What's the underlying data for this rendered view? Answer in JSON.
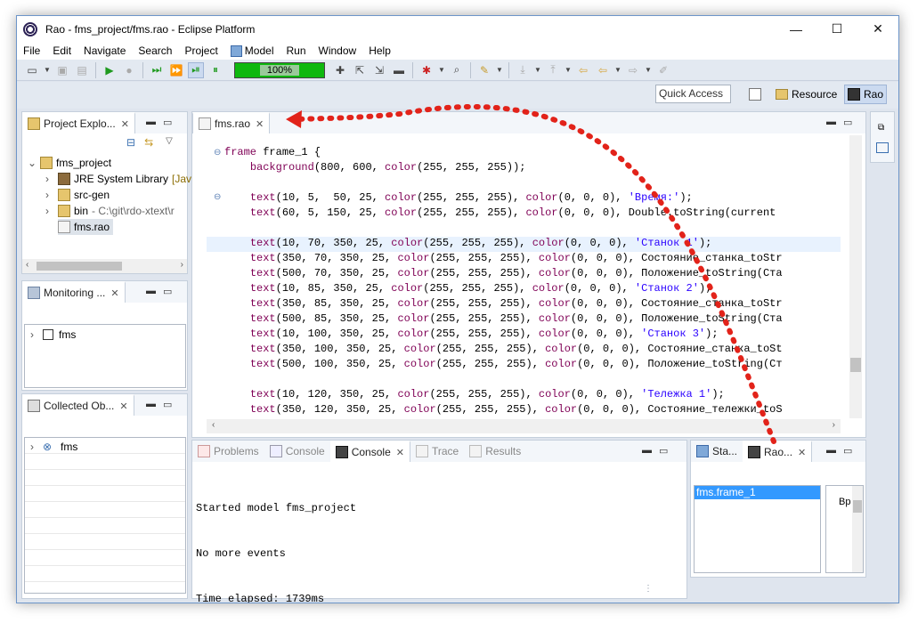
{
  "window": {
    "title": "Rao - fms_project/fms.rao - Eclipse Platform",
    "min_glyph": "—",
    "max_glyph": "☐",
    "close_glyph": "✕"
  },
  "menu": [
    "File",
    "Edit",
    "Navigate",
    "Search",
    "Project",
    "Model",
    "Run",
    "Window",
    "Help"
  ],
  "toolbar": {
    "speed_label": "100%",
    "quick_access_placeholder": "Quick Access"
  },
  "perspectives": {
    "resource_label": "Resource",
    "rao_label": "Rao"
  },
  "project_explorer": {
    "tab_label": "Project Explo...",
    "tree": [
      {
        "label": "fms_project",
        "expanded": true,
        "level": 0
      },
      {
        "label": "JRE System Library",
        "suffix": "[Java",
        "level": 1
      },
      {
        "label": "src-gen",
        "level": 1
      },
      {
        "label": "bin",
        "suffix": "- C:\\git\\rdo-xtext\\r",
        "level": 1
      },
      {
        "label": "fms.rao",
        "selected": true,
        "level": 1
      }
    ]
  },
  "monitoring": {
    "tab_label": "Monitoring ...",
    "items": [
      {
        "label": "fms"
      }
    ]
  },
  "collected": {
    "tab_label": "Collected Ob...",
    "items": [
      {
        "label": "fms"
      }
    ]
  },
  "editor": {
    "tab_label": "fms.rao",
    "lines": [
      [
        {
          "t": "kw",
          "v": "frame"
        },
        {
          "t": "plain",
          "v": " frame_1 {"
        }
      ],
      [
        {
          "t": "plain",
          "v": "    "
        },
        {
          "t": "kw",
          "v": "background"
        },
        {
          "t": "plain",
          "v": "(800, 600, "
        },
        {
          "t": "kw",
          "v": "color"
        },
        {
          "t": "plain",
          "v": "(255, 255, 255));"
        }
      ],
      [],
      [
        {
          "t": "plain",
          "v": "    "
        },
        {
          "t": "kw",
          "v": "text"
        },
        {
          "t": "plain",
          "v": "(10, 5,  50, 25, "
        },
        {
          "t": "kw",
          "v": "color"
        },
        {
          "t": "plain",
          "v": "(255, 255, 255), "
        },
        {
          "t": "kw",
          "v": "color"
        },
        {
          "t": "plain",
          "v": "(0, 0, 0), "
        },
        {
          "t": "str",
          "v": "'Время:'"
        },
        {
          "t": "plain",
          "v": ");"
        }
      ],
      [
        {
          "t": "plain",
          "v": "    "
        },
        {
          "t": "kw",
          "v": "text"
        },
        {
          "t": "plain",
          "v": "(60, 5, 150, 25, "
        },
        {
          "t": "kw",
          "v": "color"
        },
        {
          "t": "plain",
          "v": "(255, 255, 255), "
        },
        {
          "t": "kw",
          "v": "color"
        },
        {
          "t": "plain",
          "v": "(0, 0, 0), Double.toString(current"
        }
      ],
      [],
      [
        {
          "t": "plain",
          "v": "    "
        },
        {
          "t": "kw",
          "v": "text"
        },
        {
          "t": "plain",
          "v": "(10, 70, 350, 25, "
        },
        {
          "t": "kw",
          "v": "color"
        },
        {
          "t": "plain",
          "v": "(255, 255, 255), "
        },
        {
          "t": "kw",
          "v": "color"
        },
        {
          "t": "plain",
          "v": "(0, 0, 0), "
        },
        {
          "t": "str",
          "v": "'Станок 1'"
        },
        {
          "t": "plain",
          "v": ");"
        }
      ],
      [
        {
          "t": "plain",
          "v": "    "
        },
        {
          "t": "kw",
          "v": "text"
        },
        {
          "t": "plain",
          "v": "(350, 70, 350, 25, "
        },
        {
          "t": "kw",
          "v": "color"
        },
        {
          "t": "plain",
          "v": "(255, 255, 255), "
        },
        {
          "t": "kw",
          "v": "color"
        },
        {
          "t": "plain",
          "v": "(0, 0, 0), Состояние_станка_toStr"
        }
      ],
      [
        {
          "t": "plain",
          "v": "    "
        },
        {
          "t": "kw",
          "v": "text"
        },
        {
          "t": "plain",
          "v": "(500, 70, 350, 25, "
        },
        {
          "t": "kw",
          "v": "color"
        },
        {
          "t": "plain",
          "v": "(255, 255, 255), "
        },
        {
          "t": "kw",
          "v": "color"
        },
        {
          "t": "plain",
          "v": "(0, 0, 0), Положение_toString(Ста"
        }
      ],
      [
        {
          "t": "plain",
          "v": "    "
        },
        {
          "t": "kw",
          "v": "text"
        },
        {
          "t": "plain",
          "v": "(10, 85, 350, 25, "
        },
        {
          "t": "kw",
          "v": "color"
        },
        {
          "t": "plain",
          "v": "(255, 255, 255), "
        },
        {
          "t": "kw",
          "v": "color"
        },
        {
          "t": "plain",
          "v": "(0, 0, 0), "
        },
        {
          "t": "str",
          "v": "'Станок 2'"
        },
        {
          "t": "plain",
          "v": ");"
        }
      ],
      [
        {
          "t": "plain",
          "v": "    "
        },
        {
          "t": "kw",
          "v": "text"
        },
        {
          "t": "plain",
          "v": "(350, 85, 350, 25, "
        },
        {
          "t": "kw",
          "v": "color"
        },
        {
          "t": "plain",
          "v": "(255, 255, 255), "
        },
        {
          "t": "kw",
          "v": "color"
        },
        {
          "t": "plain",
          "v": "(0, 0, 0), Состояние_станка_toStr"
        }
      ],
      [
        {
          "t": "plain",
          "v": "    "
        },
        {
          "t": "kw",
          "v": "text"
        },
        {
          "t": "plain",
          "v": "(500, 85, 350, 25, "
        },
        {
          "t": "kw",
          "v": "color"
        },
        {
          "t": "plain",
          "v": "(255, 255, 255), "
        },
        {
          "t": "kw",
          "v": "color"
        },
        {
          "t": "plain",
          "v": "(0, 0, 0), Положение_toString(Ста"
        }
      ],
      [
        {
          "t": "plain",
          "v": "    "
        },
        {
          "t": "kw",
          "v": "text"
        },
        {
          "t": "plain",
          "v": "(10, 100, 350, 25, "
        },
        {
          "t": "kw",
          "v": "color"
        },
        {
          "t": "plain",
          "v": "(255, 255, 255), "
        },
        {
          "t": "kw",
          "v": "color"
        },
        {
          "t": "plain",
          "v": "(0, 0, 0), "
        },
        {
          "t": "str",
          "v": "'Станок 3'"
        },
        {
          "t": "plain",
          "v": ");"
        }
      ],
      [
        {
          "t": "plain",
          "v": "    "
        },
        {
          "t": "kw",
          "v": "text"
        },
        {
          "t": "plain",
          "v": "(350, 100, 350, 25, "
        },
        {
          "t": "kw",
          "v": "color"
        },
        {
          "t": "plain",
          "v": "(255, 255, 255), "
        },
        {
          "t": "kw",
          "v": "color"
        },
        {
          "t": "plain",
          "v": "(0, 0, 0), Состояние_станка_toSt"
        }
      ],
      [
        {
          "t": "plain",
          "v": "    "
        },
        {
          "t": "kw",
          "v": "text"
        },
        {
          "t": "plain",
          "v": "(500, 100, 350, 25, "
        },
        {
          "t": "kw",
          "v": "color"
        },
        {
          "t": "plain",
          "v": "(255, 255, 255), "
        },
        {
          "t": "kw",
          "v": "color"
        },
        {
          "t": "plain",
          "v": "(0, 0, 0), Положение_toString(Ст"
        }
      ],
      [],
      [
        {
          "t": "plain",
          "v": "    "
        },
        {
          "t": "kw",
          "v": "text"
        },
        {
          "t": "plain",
          "v": "(10, 120, 350, 25, "
        },
        {
          "t": "kw",
          "v": "color"
        },
        {
          "t": "plain",
          "v": "(255, 255, 255), "
        },
        {
          "t": "kw",
          "v": "color"
        },
        {
          "t": "plain",
          "v": "(0, 0, 0), "
        },
        {
          "t": "str",
          "v": "'Тележка 1'"
        },
        {
          "t": "plain",
          "v": ");"
        }
      ],
      [
        {
          "t": "plain",
          "v": "    "
        },
        {
          "t": "kw",
          "v": "text"
        },
        {
          "t": "plain",
          "v": "(350, 120, 350, 25, "
        },
        {
          "t": "kw",
          "v": "color"
        },
        {
          "t": "plain",
          "v": "(255, 255, 255), "
        },
        {
          "t": "kw",
          "v": "color"
        },
        {
          "t": "plain",
          "v": "(0, 0, 0), Состояние_тележки_toS"
        }
      ]
    ]
  },
  "bottom": {
    "tabs": [
      "Problems",
      "Console",
      "Console",
      "Trace",
      "Results"
    ],
    "console_lines": [
      "Started model fms_project",
      "No more events",
      "Time elapsed: 1739ms"
    ]
  },
  "right_panel": {
    "tabs": [
      "Sta...",
      "Rao..."
    ],
    "list_item": "fms.frame_1",
    "preview_text": "Вр"
  },
  "colors": {
    "accent": "#cbdaf0",
    "arrow": "#e2231a",
    "progress": "#0eb80e"
  }
}
